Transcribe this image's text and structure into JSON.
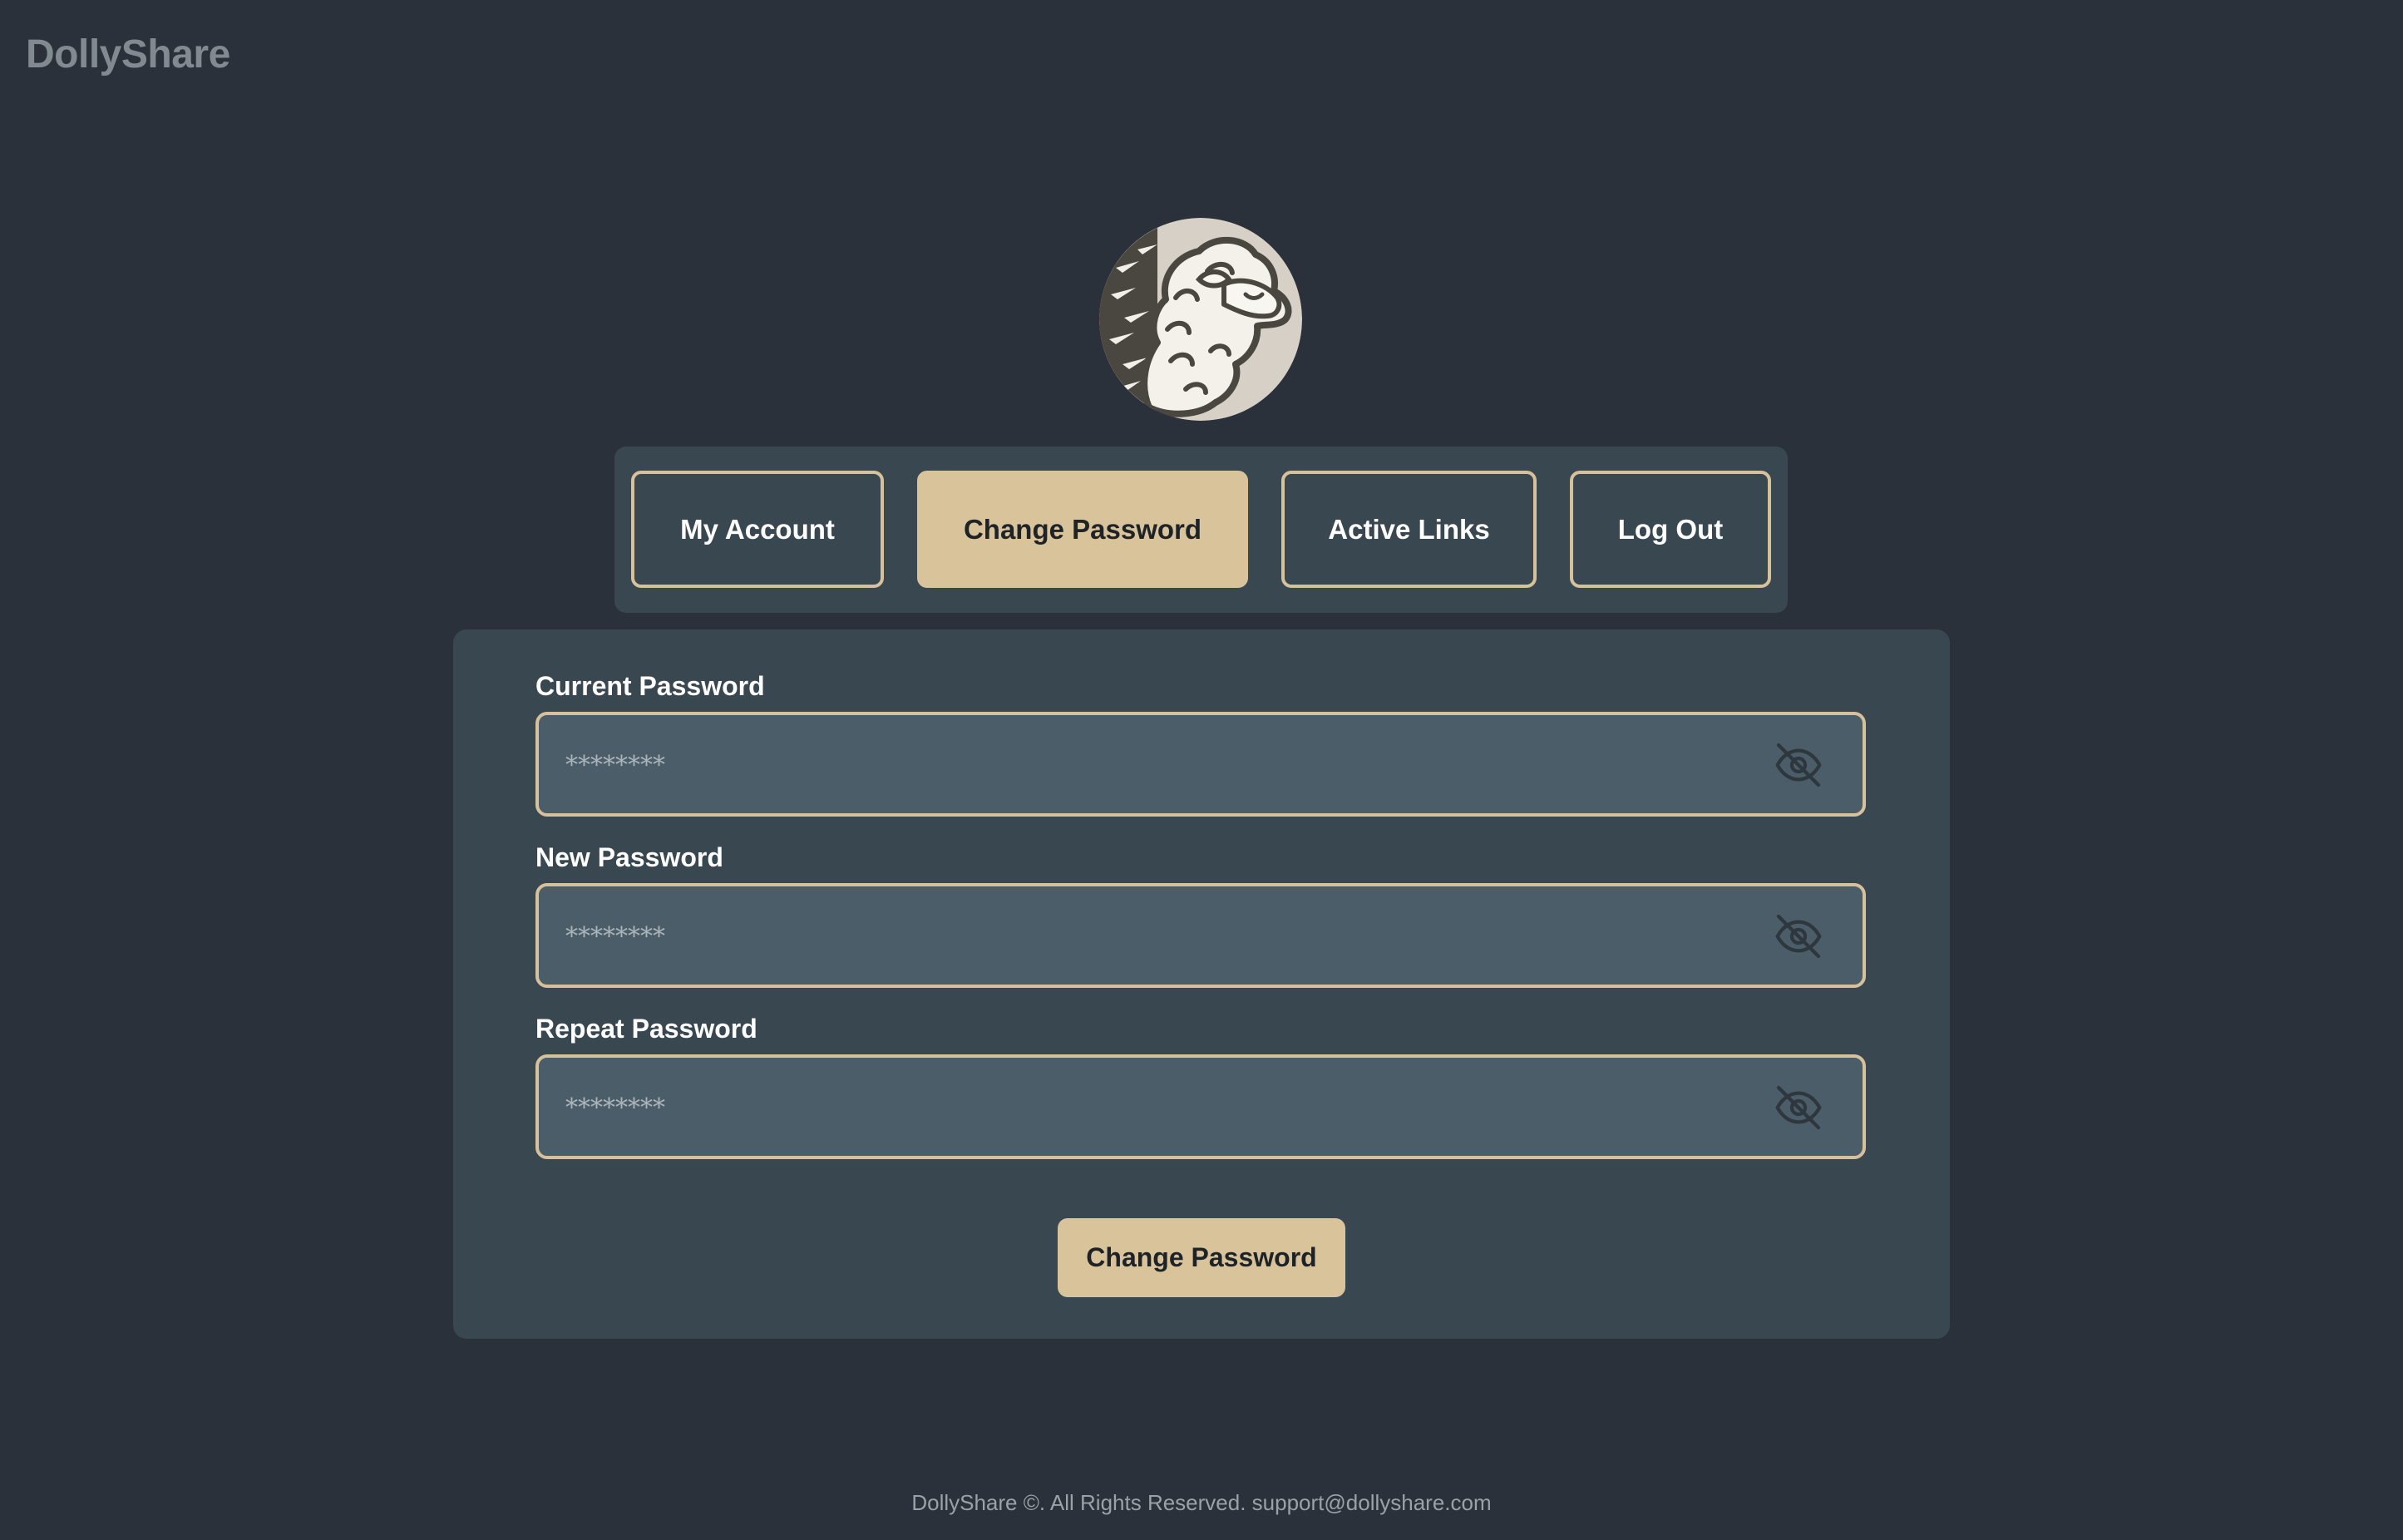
{
  "brand": "DollyShare",
  "nav": {
    "items": [
      {
        "label": "My Account",
        "active": false
      },
      {
        "label": "Change Password",
        "active": true
      },
      {
        "label": "Active Links",
        "active": false
      },
      {
        "label": "Log Out",
        "active": false
      }
    ]
  },
  "form": {
    "fields": [
      {
        "label": "Current Password",
        "placeholder": "********",
        "icon": "eye-off-icon"
      },
      {
        "label": "New Password",
        "placeholder": "********",
        "icon": "eye-off-icon"
      },
      {
        "label": "Repeat Password",
        "placeholder": "********",
        "icon": "eye-off-icon"
      }
    ],
    "submit_label": "Change Password"
  },
  "footer": "DollyShare ©. All Rights Reserved. support@dollyshare.com",
  "colors": {
    "background": "#2a313a",
    "panel": "#394751",
    "input": "#4b5d69",
    "accent": "#d8c39b",
    "brand_text": "#828a91"
  }
}
